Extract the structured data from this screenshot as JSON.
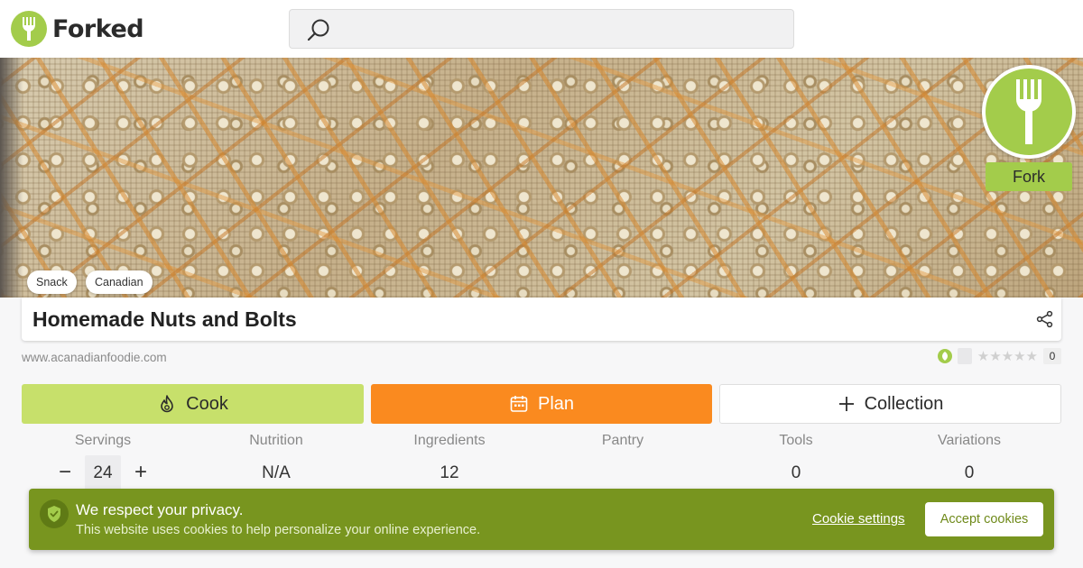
{
  "header": {
    "logo_text": "Forked",
    "logo_icon": "fork-icon",
    "search": {
      "placeholder": "",
      "icon": "search-icon"
    }
  },
  "hero": {
    "tags": [
      "Snack",
      "Canadian"
    ],
    "fork_label": "Fork"
  },
  "recipe": {
    "title": "Homemade Nuts and Bolts",
    "source": "www.acanadianfoodie.com",
    "rating_count": "0",
    "stars": "★★★★★"
  },
  "actions": {
    "cook": "Cook",
    "plan": "Plan",
    "collection": "Collection"
  },
  "stats": [
    {
      "label": "Servings",
      "value": "24"
    },
    {
      "label": "Nutrition",
      "value": "N/A"
    },
    {
      "label": "Ingredients",
      "value": "12"
    },
    {
      "label": "Pantry",
      "value": ""
    },
    {
      "label": "Tools",
      "value": "0"
    },
    {
      "label": "Variations",
      "value": "0"
    }
  ],
  "stepper": {
    "minus": "−",
    "plus": "+"
  },
  "cookie": {
    "title": "We respect your privacy.",
    "text": "This website uses cookies to help personalize your online experience.",
    "settings": "Cookie settings",
    "accept": "Accept cookies"
  },
  "colors": {
    "brand_green": "#a3cc4b",
    "cook_green": "#c7e06b",
    "plan_orange": "#fa8a1f",
    "cookie_green": "#78951f"
  }
}
